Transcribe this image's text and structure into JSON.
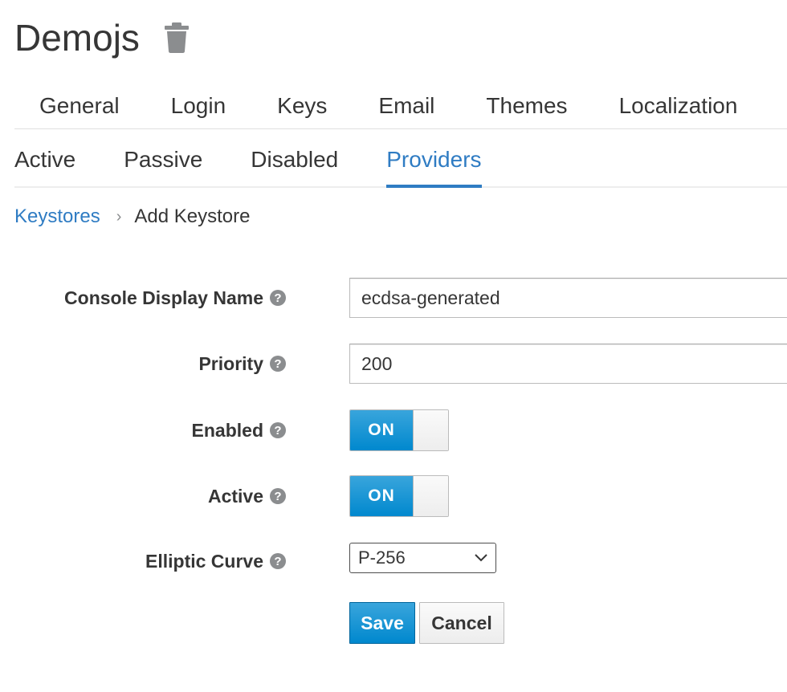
{
  "header": {
    "realm_name": "Demojs",
    "delete_icon": "trash-icon"
  },
  "tabs": [
    {
      "label": "General"
    },
    {
      "label": "Login"
    },
    {
      "label": "Keys"
    },
    {
      "label": "Email"
    },
    {
      "label": "Themes"
    },
    {
      "label": "Localization"
    }
  ],
  "subtabs": [
    {
      "label": "Active"
    },
    {
      "label": "Passive"
    },
    {
      "label": "Disabled"
    },
    {
      "label": "Providers",
      "active": true
    }
  ],
  "breadcrumb": {
    "parent": "Keystores",
    "separator": "›",
    "current": "Add Keystore"
  },
  "form": {
    "display_name": {
      "label": "Console Display Name",
      "value": "ecdsa-generated"
    },
    "priority": {
      "label": "Priority",
      "value": "200"
    },
    "enabled": {
      "label": "Enabled",
      "state": "ON"
    },
    "active": {
      "label": "Active",
      "state": "ON"
    },
    "elliptic_curve": {
      "label": "Elliptic Curve",
      "value": "P-256"
    },
    "help_glyph": "?"
  },
  "actions": {
    "save_label": "Save",
    "cancel_label": "Cancel"
  },
  "colors": {
    "accent": "#2f7cc3",
    "toggle_on": "#0088ce",
    "text": "#363636"
  }
}
